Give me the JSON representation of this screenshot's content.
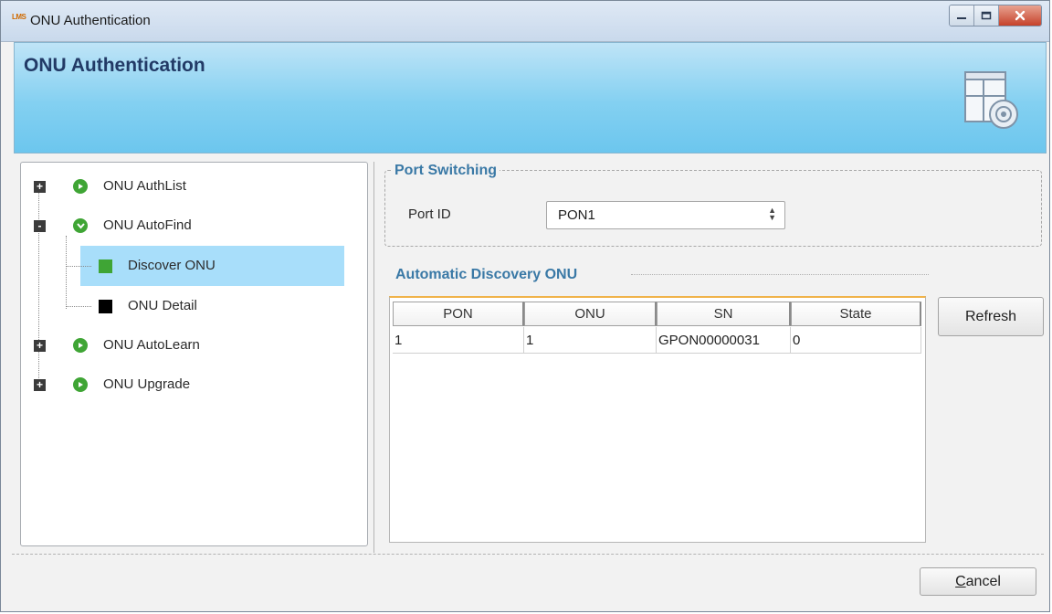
{
  "window": {
    "app_icon_text": "LMS",
    "title": "ONU Authentication",
    "controls": [
      "minimize-icon",
      "maximize-icon",
      "close-icon"
    ]
  },
  "header": {
    "title": "ONU Authentication",
    "icon": "settings-window-icon"
  },
  "tree": {
    "items": [
      {
        "label": "ONU AuthList",
        "expander": "+",
        "icon": "play-circle-icon"
      },
      {
        "label": "ONU AutoFind",
        "expander": "-",
        "icon": "chevron-down-circle-icon"
      },
      {
        "label": "Discover ONU",
        "icon": "green-square-icon",
        "selected": true
      },
      {
        "label": "ONU Detail",
        "icon": "black-square-icon"
      },
      {
        "label": "ONU AutoLearn",
        "expander": "+",
        "icon": "play-circle-icon"
      },
      {
        "label": "ONU Upgrade",
        "expander": "+",
        "icon": "play-circle-icon"
      }
    ]
  },
  "port_switching": {
    "title": "Port Switching",
    "port_id_label": "Port ID",
    "port_id_value": "PON1"
  },
  "discovery": {
    "title": "Automatic Discovery ONU",
    "columns": [
      "PON",
      "ONU",
      "SN",
      "State"
    ],
    "rows": [
      [
        "1",
        "1",
        "GPON00000031",
        "0"
      ]
    ]
  },
  "buttons": {
    "refresh": "Refresh",
    "cancel_first": "C",
    "cancel_rest": "ancel"
  },
  "colors": {
    "accent_title": "#3a79a6",
    "banner": "#83d0f1",
    "selection": "#a8defa",
    "tree_icon_green": "#3fa535",
    "table_top_border": "#f0b34a"
  }
}
